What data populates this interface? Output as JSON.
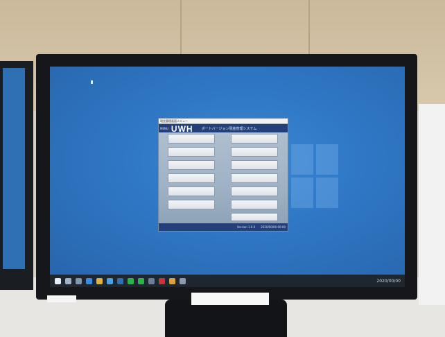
{
  "app": {
    "titlebar": "現金管理画面メニュー",
    "small_logo": "MENU",
    "logo": "UWH",
    "system_name": "ポートバージョン現金管理システム",
    "left_buttons": [
      "",
      "",
      "",
      "",
      "",
      ""
    ],
    "right_buttons": [
      "",
      "",
      "",
      "",
      "",
      "",
      "",
      ""
    ],
    "footer": {
      "version": "Version 1.0.0",
      "date": "2020/00/00 00:00"
    }
  },
  "taskbar": {
    "clock": "2020/00/00"
  },
  "stickers": {
    "monitor_label": "",
    "note": ""
  },
  "colors": {
    "desktop": "#2f77c4",
    "app_header": "#23407a",
    "taskbar": "#1e2630"
  },
  "icons": [
    "start-icon",
    "search-icon",
    "task-view-icon",
    "edge-icon",
    "explorer-icon",
    "store-icon",
    "mail-icon"
  ]
}
